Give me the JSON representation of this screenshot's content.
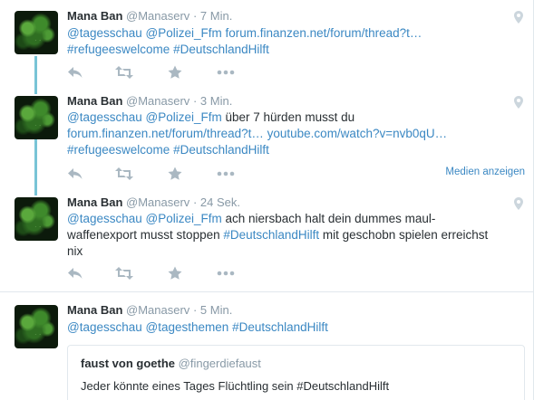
{
  "tweets": [
    {
      "name": "Mana Ban",
      "handle": "@Manaserv",
      "dot": "·",
      "time": "7 Min.",
      "line1": [
        "@tagesschau",
        " ",
        "@Polizei_Ffm",
        " ",
        "forum.finanzen.net/forum/thread?t…"
      ],
      "line2": [
        "#refugeeswelcome",
        " ",
        "#DeutschlandHilft"
      ]
    },
    {
      "name": "Mana Ban",
      "handle": "@Manaserv",
      "dot": "·",
      "time": "3 Min.",
      "line1": [
        "@tagesschau",
        " ",
        "@Polizei_Ffm",
        " über 7 hürden musst du"
      ],
      "line2": [
        "forum.finanzen.net/forum/thread?t…",
        " ",
        "youtube.com/watch?v=nvb0qU…"
      ],
      "line3": [
        "#refugeeswelcome",
        " ",
        "#DeutschlandHilft"
      ],
      "media_label": "Medien anzeigen"
    },
    {
      "name": "Mana Ban",
      "handle": "@Manaserv",
      "dot": "·",
      "time": "24 Sek.",
      "line1": [
        "@tagesschau",
        " ",
        "@Polizei_Ffm",
        " ach niersbach halt dein dummes maul-"
      ],
      "line2": [
        "waffenexport musst stoppen ",
        "#DeutschlandHilft",
        " mit geschobn spielen erreichst"
      ],
      "line3": "nix"
    },
    {
      "name": "Mana Ban",
      "handle": "@Manaserv",
      "dot": "·",
      "time": "5 Min.",
      "line1": [
        "@tagesschau",
        " ",
        "@tagesthemen",
        " ",
        "#DeutschlandHilft"
      ],
      "quote": {
        "name": "faust von goethe",
        "handle": "@fingerdiefaust",
        "text": "Jeder könnte eines Tages Flüchtling sein #DeutschlandHilft"
      }
    }
  ],
  "icons": {
    "reply": "reply-icon",
    "retweet": "retweet-icon",
    "favorite": "star-icon",
    "more": "more-icon",
    "geo": "location-pin-icon"
  },
  "colors": {
    "link": "#3b88c3",
    "thread_line": "#79c4d6",
    "muted": "#8899a6",
    "action_icon": "#aab8c2"
  }
}
